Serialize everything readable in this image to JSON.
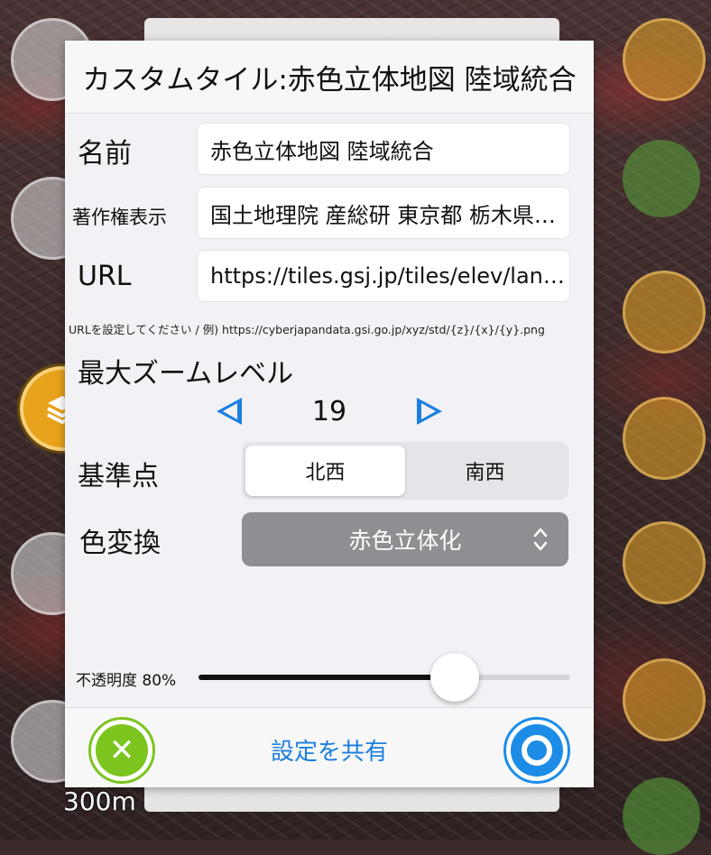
{
  "dialog": {
    "title": "カスタムタイル:赤色立体地図 陸域統合",
    "name_label": "名前",
    "name_value": "赤色立体地図 陸域統合",
    "copyright_label": "著作権表示",
    "copyright_value": "国土地理院 産総研 東京都 栃木県…",
    "url_label": "URL",
    "url_value": "https://tiles.gsj.jp/tiles/elev/lan…",
    "url_hint": "URLを設定してください / 例) https://cyberjapandata.gsi.go.jp/xyz/std/{z}/{x}/{y}.png",
    "max_zoom_label": "最大ズームレベル",
    "max_zoom_value": "19",
    "origin_label": "基準点",
    "origin_options": [
      "北西",
      "南西"
    ],
    "origin_selected": "北西",
    "color_label": "色変換",
    "color_value": "赤色立体化",
    "opacity_label": "不透明度 80%",
    "opacity_percent": 80,
    "share_label": "設定を共有"
  },
  "map": {
    "scale_text": "300m"
  },
  "colors": {
    "accent_blue": "#1d7fe0",
    "cancel_green": "#7cc41e",
    "select_gray": "#8e8e93",
    "active_layer_orange": "#e8a21c"
  }
}
